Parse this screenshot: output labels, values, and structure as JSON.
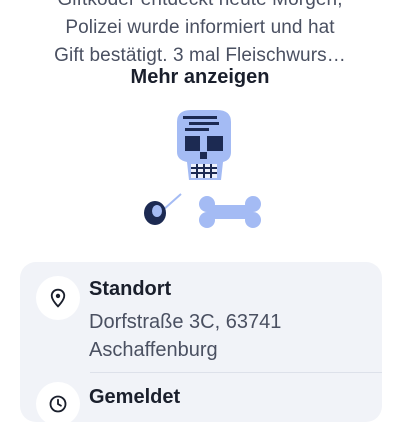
{
  "report": {
    "description_lines": [
      "Giftköder entdeckt heute Morgen,",
      "Polizei wurde informiert und hat",
      "Gift bestätigt. 3 mal Fleischwurs…"
    ],
    "show_more_label": "Mehr anzeigen"
  },
  "illustration": {
    "icon": "poison-skull-bone-pin-illustration",
    "colors": {
      "skull": "#a4bbf4",
      "dark": "#1c2a52",
      "bone": "#a4bbf4"
    }
  },
  "details": {
    "location": {
      "icon": "location-pin-icon",
      "title": "Standort",
      "address_line1": "Dorfstraße 3C, 63741",
      "address_line2": "Aschaffenburg"
    },
    "reported": {
      "icon": "clock-icon",
      "title": "Gemeldet"
    }
  }
}
